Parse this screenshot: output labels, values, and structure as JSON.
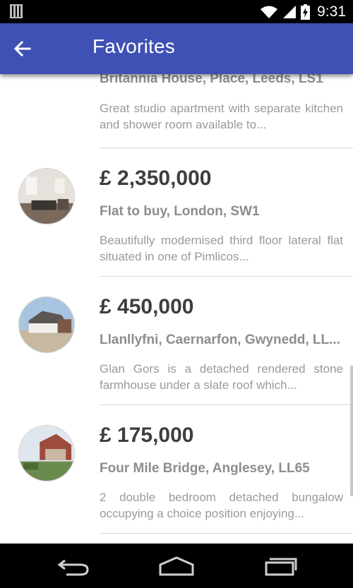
{
  "status_bar": {
    "time": "9:31",
    "icons": [
      "notification-icon",
      "wifi-icon",
      "signal-icon",
      "battery-charging-icon"
    ]
  },
  "app_bar": {
    "title": "Favorites",
    "back_icon": "arrow-back-icon",
    "color": "#3f51b5"
  },
  "listings": [
    {
      "price": "",
      "address": "Britannia House, Place, Leeds, LS1",
      "description": "Great studio apartment with separate kitchen and shower room available to..."
    },
    {
      "price": "£ 2,350,000",
      "address": "Flat to buy, London, SW1",
      "description": "Beautifully modernised third floor lateral flat situated in one of Pimlicos..."
    },
    {
      "price": "£ 450,000",
      "address": "Llanllyfni, Caernarfon, Gwynedd, LL...",
      "description": "Glan Gors is a detached rendered stone farmhouse under a slate roof which..."
    },
    {
      "price": "£ 175,000",
      "address": "Four Mile Bridge, Anglesey, LL65",
      "description": "2 double bedroom detached bungalow occupying a choice position enjoying..."
    }
  ],
  "nav_bar": {
    "icons": [
      "back-nav-icon",
      "home-nav-icon",
      "recent-apps-icon"
    ]
  }
}
